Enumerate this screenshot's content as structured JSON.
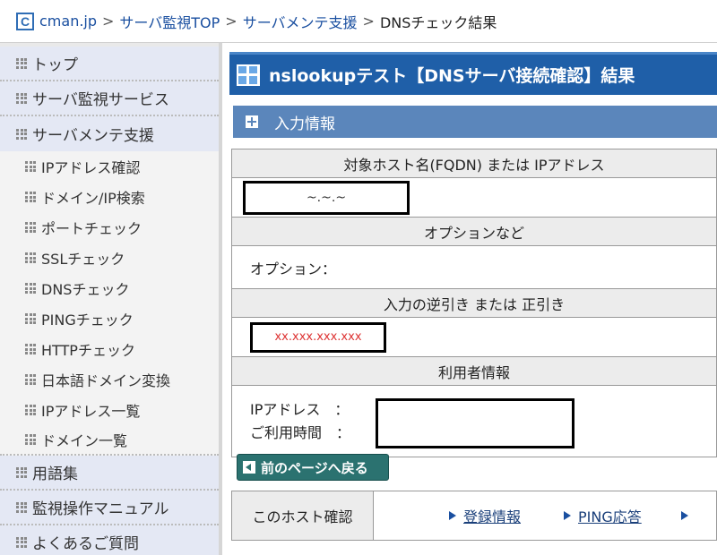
{
  "breadcrumb": {
    "logo_letter": "C",
    "items": [
      "cman.jp",
      "サーバ監視TOP",
      "サーバメンテ支援"
    ],
    "separator": ">",
    "current": "DNSチェック結果"
  },
  "sidebar": {
    "items": [
      {
        "label": "トップ",
        "level": "main"
      },
      {
        "label": "サーバ監視サービス",
        "level": "main"
      },
      {
        "label": "サーバメンテ支援",
        "level": "main"
      },
      {
        "label": "IPアドレス確認",
        "level": "sub"
      },
      {
        "label": "ドメイン/IP検索",
        "level": "sub"
      },
      {
        "label": "ポートチェック",
        "level": "sub"
      },
      {
        "label": "SSLチェック",
        "level": "sub"
      },
      {
        "label": "DNSチェック",
        "level": "sub"
      },
      {
        "label": "PINGチェック",
        "level": "sub"
      },
      {
        "label": "HTTPチェック",
        "level": "sub"
      },
      {
        "label": "日本語ドメイン変換",
        "level": "sub"
      },
      {
        "label": "IPアドレス一覧",
        "level": "sub"
      },
      {
        "label": "ドメイン一覧",
        "level": "sub"
      },
      {
        "label": "用語集",
        "level": "main"
      },
      {
        "label": "監視操作マニュアル",
        "level": "main"
      },
      {
        "label": "よくあるご質問",
        "level": "main"
      }
    ]
  },
  "main": {
    "title": "nslookupテスト【DNSサーバ接続確認】結果",
    "section_title": "入力情報",
    "table": {
      "host_header": "対象ホスト名(FQDN) または IPアドレス",
      "host_value": "~.~.~",
      "option_header": "オプションなど",
      "option_label": "オプション：",
      "reverse_header": "入力の逆引き または 正引き",
      "reverse_value": "xx.xxx.xxx.xxx",
      "user_header": "利用者情報",
      "ip_label": "IPアドレス　：",
      "time_label": "ご利用時間　："
    },
    "back_button": "前のページへ戻る",
    "host_bar": {
      "label": "このホスト確認",
      "links": [
        "登録情報",
        "PING応答"
      ]
    }
  },
  "colors": {
    "title_bar": "#1f5fa8",
    "section_head": "#5b86bb",
    "back_button": "#2b7270",
    "link": "#1a4fa0",
    "reverse_value": "#dd3333"
  }
}
